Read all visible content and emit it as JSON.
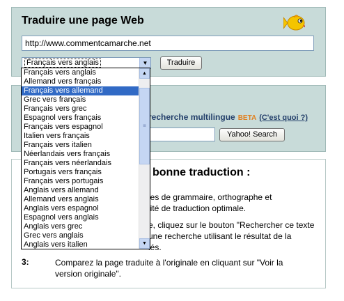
{
  "translate_panel": {
    "title": "Traduire une page Web",
    "url_value": "http://www.commentcamarche.net",
    "selected_language": "Français vers anglais",
    "translate_button": "Traduire"
  },
  "search_panel": {
    "label": "recherche multilingue",
    "beta": "BETA",
    "whatsit": "(C'est quoi ?)",
    "search_button": "Yahoo! Search"
  },
  "tips_panel": {
    "title": "bonne traduction :",
    "line1a": "les de grammaire, orthographe et",
    "line1b": "lité de traduction optimale.",
    "line2a": "e, cliquez sur le bouton \"Rechercher ce texte",
    "line2b": "une recherche utilisant le résultat de la",
    "line2c": "iés.",
    "num3": "3:",
    "line3a": "Comparez la page traduite à l'originale en cliquant sur \"Voir la",
    "line3b": "version originale\"."
  },
  "dropdown": {
    "options": [
      "Français vers anglais",
      "Allemand vers français",
      "Français vers allemand",
      "Grec vers français",
      "Français vers grec",
      "Espagnol vers français",
      "Français vers espagnol",
      "Italien vers français",
      "Français vers italien",
      "Néerlandais vers français",
      "Français vers néerlandais",
      "Portugais vers français",
      "Français vers portugais",
      "Anglais vers allemand",
      "Allemand vers anglais",
      "Anglais vers espagnol",
      "Espagnol vers anglais",
      "Anglais vers grec",
      "Grec vers anglais",
      "Anglais vers italien"
    ],
    "highlighted": "Français vers allemand"
  },
  "icons": {
    "fish": "fish-icon",
    "dropdown_arrow": "chevron-down-icon"
  },
  "colors": {
    "panel_bg": "#c8dbd9",
    "selection": "#316ac5",
    "beta": "#e07f1e",
    "link": "#24406b"
  }
}
